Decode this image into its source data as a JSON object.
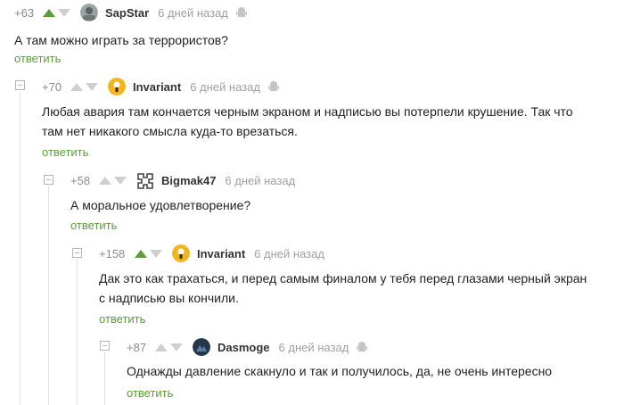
{
  "comments": [
    {
      "rating": "+63",
      "author": "SapStar",
      "time": "6 дней назад",
      "lines": [
        "А там можно играть за террористов?"
      ],
      "reply": "ответить",
      "vote_up_active": true,
      "avatar_icon": "user-avatar-icon"
    },
    {
      "rating": "+70",
      "author": "Invariant",
      "time": "6 дней назад",
      "lines": [
        "Любая авария там кончается черным экраном и надписью вы потерпели крушение. Так что",
        "там нет никакого смысла куда-то врезаться."
      ],
      "reply": "ответить",
      "vote_up_active": false,
      "avatar_icon": "light-bulb-avatar-icon"
    },
    {
      "rating": "+58",
      "author": "Bigmak47",
      "time": "6 дней назад",
      "lines": [
        "А моральное удовлетворение?"
      ],
      "reply": "ответить",
      "vote_up_active": false,
      "avatar_icon": "logo-avatar-icon"
    },
    {
      "rating": "+158",
      "author": "Invariant",
      "time": "6 дней назад",
      "lines": [
        "Дак это как трахаться, и перед самым финалом у тебя перед глазами черный экран",
        "с надписью вы кончили."
      ],
      "reply": "ответить",
      "vote_up_active": true,
      "avatar_icon": "light-bulb-avatar-icon"
    },
    {
      "rating": "+87",
      "author": "Dasmoge",
      "time": "6 дней назад",
      "lines": [
        "Однажды давление скакнуло и так и получилось, да, не очень интересно"
      ],
      "reply": "ответить",
      "vote_up_active": false,
      "avatar_icon": "dark-avatar-icon"
    }
  ],
  "colors": {
    "accent_green": "#5d9c3a",
    "vote_inactive": "#cfcfcf",
    "muted_text": "#8b8b8b"
  }
}
